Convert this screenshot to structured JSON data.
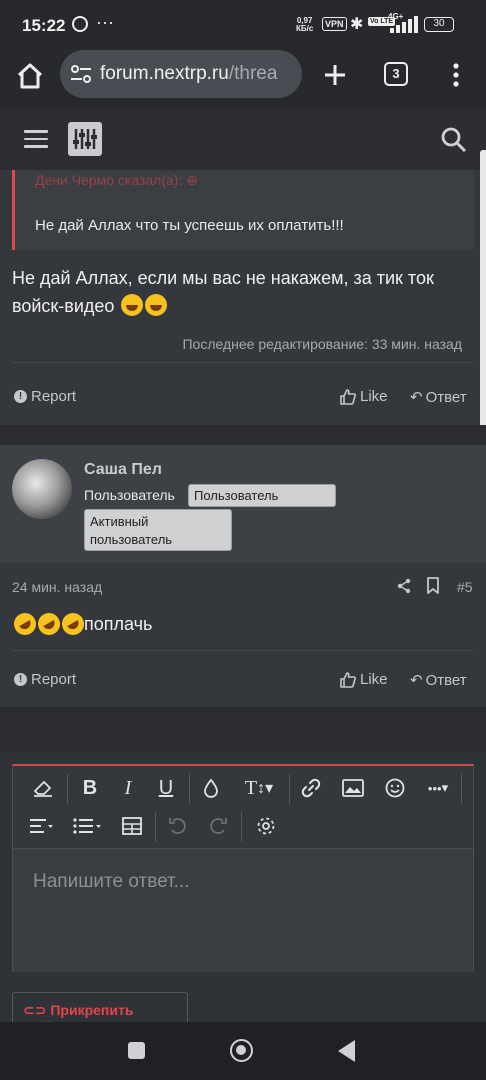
{
  "status_bar": {
    "time": "15:22",
    "speed": "0,97",
    "speed_unit": "КБ/с",
    "vpn": "VPN",
    "volte": "Vo LTE",
    "network": "4G+",
    "battery": "30"
  },
  "browser": {
    "url_host": "forum.nextrp.ru",
    "url_path": "/threa",
    "tab_count": "3"
  },
  "post1": {
    "quote_author": "Дени Чермо сказал(а):",
    "quote_text": "Не дай Аллах что ты успеешь их оплатить!!!",
    "message": "Не дай Аллах, если мы вас не накажем, за тик ток войск-видео",
    "edited": "Последнее редактирование: 33 мин. назад",
    "report": "Report",
    "like": "Like",
    "reply": "Ответ"
  },
  "post2": {
    "username": "Саша Пел",
    "user_title": "Пользователь",
    "badge1": "Пользователь",
    "badge2": "Активный пользователь",
    "time": "24 мин. назад",
    "number": "#5",
    "message": "поплачь",
    "report": "Report",
    "like": "Like",
    "reply": "Ответ"
  },
  "editor": {
    "placeholder": "Напишите ответ...",
    "attach": "Прикрепить файлы",
    "bold": "B",
    "italic": "I",
    "underline": "U",
    "text_size": "T",
    "more": "•••"
  },
  "colors": {
    "accent": "#e0474f",
    "background": "#34373c",
    "header": "#2c2e33"
  }
}
